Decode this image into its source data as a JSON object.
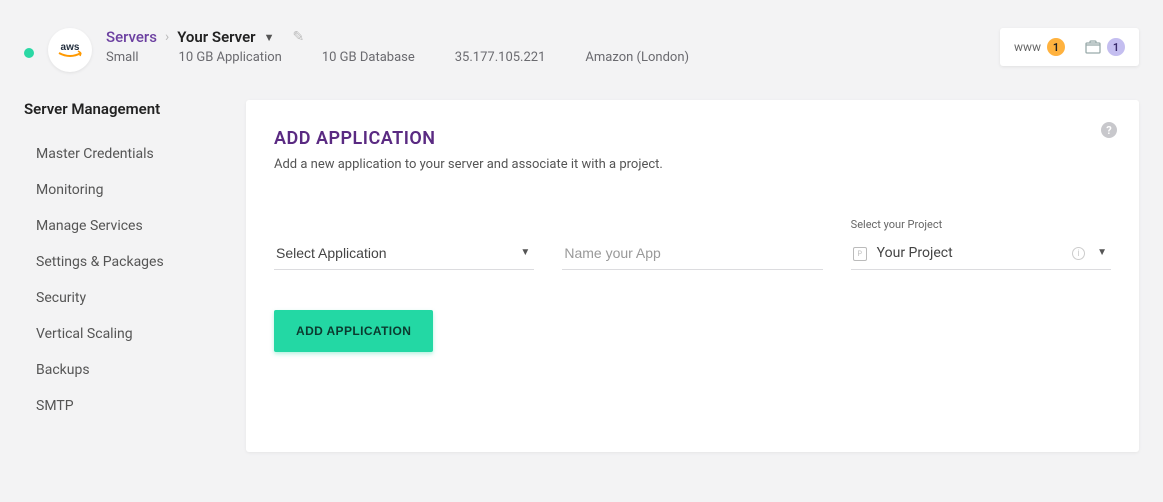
{
  "header": {
    "logo_text_top": "aws",
    "breadcrumb_link": "Servers",
    "breadcrumb_current": "Your Server",
    "meta": {
      "size": "Small",
      "app_disk": "10 GB Application",
      "db_disk": "10 GB Database",
      "ip": "35.177.105.221",
      "provider": "Amazon (London)"
    },
    "www_label": "www",
    "www_badge": "1",
    "wallet_badge": "1"
  },
  "sidebar": {
    "heading": "Server Management",
    "items": [
      "Master Credentials",
      "Monitoring",
      "Manage Services",
      "Settings & Packages",
      "Security",
      "Vertical Scaling",
      "Backups",
      "SMTP"
    ]
  },
  "card": {
    "title": "ADD APPLICATION",
    "subtitle": "Add a new application to your server and associate it with a project.",
    "select_app_label": "Select Application",
    "name_app_placeholder": "Name your App",
    "project_label": "Select your Project",
    "project_value": "Your Project",
    "button_label": "ADD APPLICATION"
  }
}
